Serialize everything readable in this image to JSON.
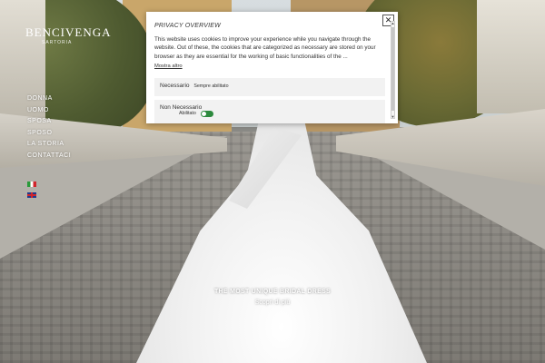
{
  "brand": {
    "name": "BENCIVENGA",
    "tagline": "SARTORIA"
  },
  "nav": {
    "items": [
      "DONNA",
      "UOMO",
      "SPOSA",
      "SPOSO",
      "LA STORIA",
      "CONTATTACI"
    ],
    "flags": [
      "italian-flag-icon",
      "uk-flag-icon"
    ]
  },
  "hero": {
    "title": "THE MOST UNIQUE BRIDAL DRESS",
    "link": "Scopri di più"
  },
  "cookie_modal": {
    "title": "PRIVACY OVERVIEW",
    "close_symbol": "✕",
    "text": "This website uses cookies to improve your experience while you navigate through the website. Out of these, the cookies that are categorized as necessary are stored on your browser as they are essential for the working of basic functionalities of the ...",
    "read_more": "Mostra altro",
    "necessary": {
      "label": "Necessario",
      "status": "Sempre abilitato"
    },
    "non_necessary": {
      "label": "Non Necessario",
      "toggle_label": "Abilitato",
      "enabled": true
    }
  },
  "colors": {
    "toggle_on": "#2d8a3e",
    "panel_bg": "#f2f2f2",
    "modal_bg": "#ffffff"
  }
}
